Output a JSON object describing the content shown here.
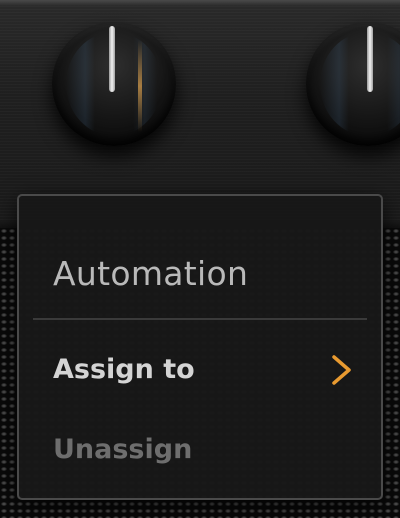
{
  "menu": {
    "title": "Automation",
    "items": [
      {
        "label": "Assign to",
        "enabled": true,
        "has_submenu": true,
        "icon": "chevron-right-icon"
      },
      {
        "label": "Unassign",
        "enabled": false,
        "has_submenu": false
      }
    ]
  },
  "colors": {
    "accent": "#e89a30",
    "menu_background": "#181818",
    "menu_border": "#4a4a4a",
    "title_text": "#b9b9b9",
    "enabled_text": "#d4d4d4",
    "disabled_text": "#6e6e6e"
  },
  "knobs": [
    {
      "name": "knob-left"
    },
    {
      "name": "knob-right"
    }
  ]
}
